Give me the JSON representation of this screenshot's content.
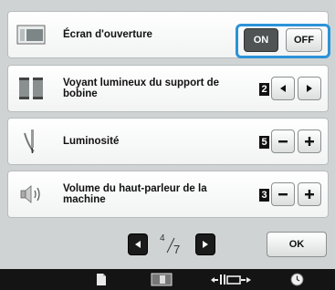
{
  "settings": [
    {
      "label": "Écran d'ouverture",
      "icon": "opening-screen-icon"
    },
    {
      "label": "Voyant lumineux du support de bobine",
      "value": "2",
      "icon": "spool-light-icon"
    },
    {
      "label": "Luminosité",
      "value": "5",
      "icon": "needle-brightness-icon"
    },
    {
      "label": "Volume du haut-parleur de la machine",
      "value": "3",
      "icon": "speaker-icon"
    }
  ],
  "toggle": {
    "on_label": "ON",
    "off_label": "OFF",
    "selected": "ON"
  },
  "pager": {
    "current": "4",
    "total": "7"
  },
  "ok_label": "OK",
  "colors": {
    "highlight": "#2b93d8",
    "background": "#cfd3d3"
  }
}
